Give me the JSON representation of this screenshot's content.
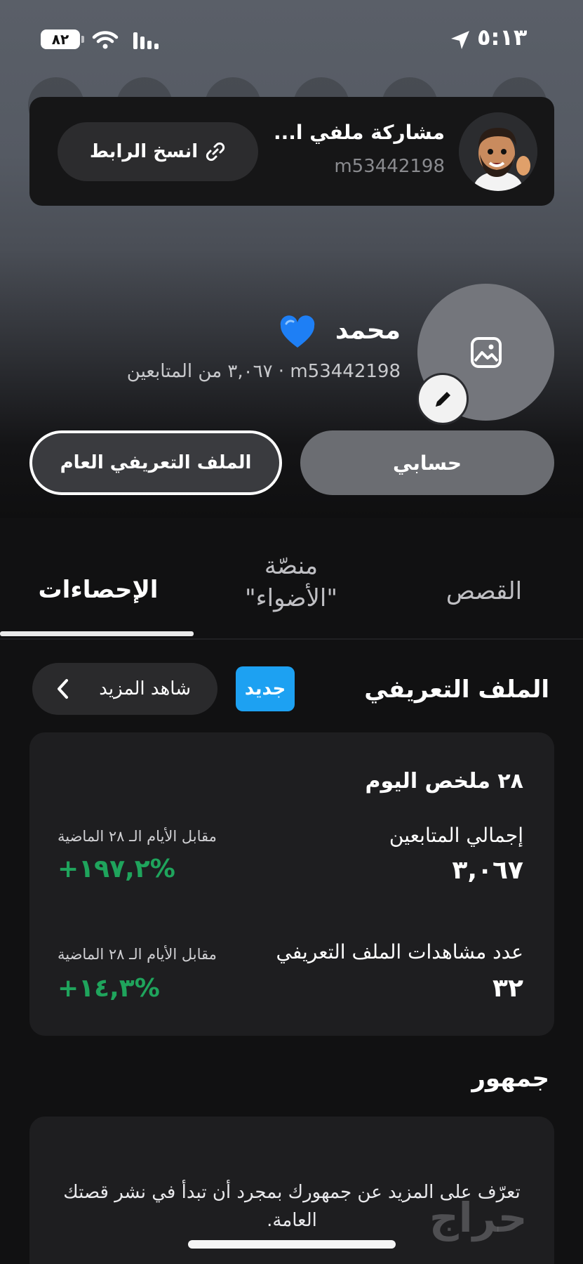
{
  "status_bar": {
    "time": "٥:١٣",
    "battery": "٨٢"
  },
  "share_banner": {
    "title": "مشاركة ملفي ا...",
    "username": "m53442198",
    "copy_link_label": "انسخ الرابط"
  },
  "profile": {
    "name": "محمد",
    "subtitle": "٣,٠٦٧ من المتابعين · m53442198",
    "my_account_button": "حسابي",
    "public_profile_button": "الملف التعريفي العام"
  },
  "tabs": {
    "stats": "الإحصاءات",
    "spotlight_line1": "منصّة",
    "spotlight_line2": "\"الأضواء\"",
    "stories": "القصص"
  },
  "profile_section": {
    "title": "الملف التعريفي",
    "badge": "جديد",
    "see_more": "شاهد المزيد"
  },
  "summary_card": {
    "title": "٢٨ ملخص اليوم",
    "total_followers_label": "إجمالي المتابعين",
    "total_followers_value": "٣,٠٦٧",
    "followers_compare_label": "مقابل الأيام الـ ٢٨ الماضية",
    "followers_change": "+١٩٧,٢%",
    "profile_views_label": "عدد مشاهدات الملف التعريفي",
    "profile_views_value": "٣٢",
    "views_compare_label": "مقابل الأيام الـ ٢٨ الماضية",
    "views_change": "+١٤,٣%"
  },
  "audience": {
    "title": "جمهور",
    "message": "تعرّف على المزيد عن جمهورك بمجرد أن تبدأ في نشر قصتك العامة."
  },
  "watermark": "حراج",
  "colors": {
    "accent_blue": "#1da1f2",
    "positive_green": "#1fa45c",
    "card_bg": "#1e1e20"
  }
}
